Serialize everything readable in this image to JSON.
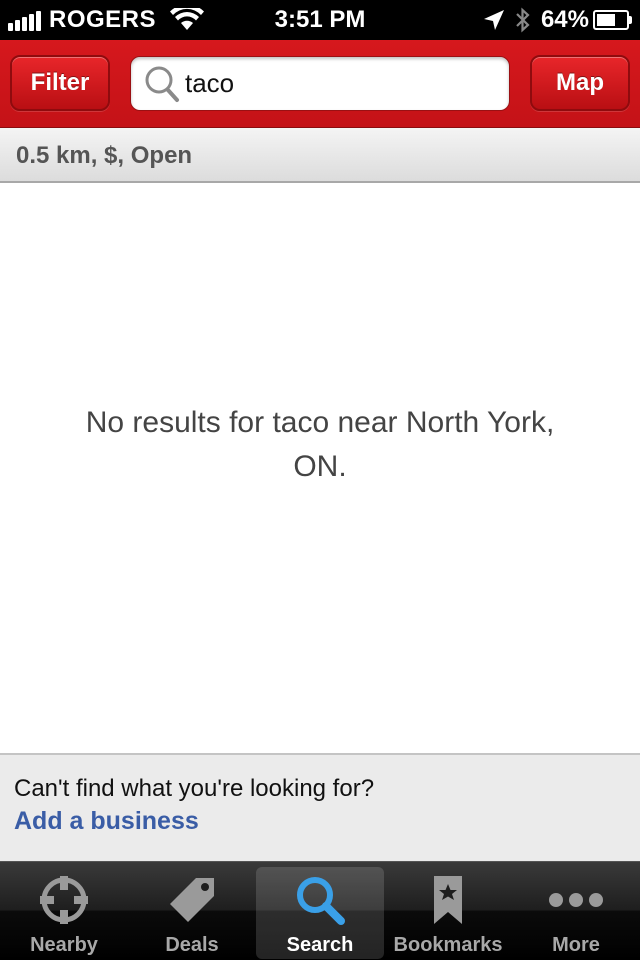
{
  "status_bar": {
    "carrier": "ROGERS",
    "time": "3:51 PM",
    "battery": "64%",
    "battery_level": 0.64
  },
  "header": {
    "filter_label": "Filter",
    "map_label": "Map",
    "search_value": "taco"
  },
  "filter_summary": "0.5 km, $, Open",
  "main": {
    "no_results": "No results for taco near North York, ON."
  },
  "prompt": {
    "text": "Can't find what you're looking for?",
    "link": "Add a business"
  },
  "tabs": [
    {
      "label": "Nearby",
      "icon": "crosshair-icon"
    },
    {
      "label": "Deals",
      "icon": "tag-icon"
    },
    {
      "label": "Search",
      "icon": "search-icon",
      "active": true
    },
    {
      "label": "Bookmarks",
      "icon": "bookmark-icon"
    },
    {
      "label": "More",
      "icon": "more-icon"
    }
  ],
  "colors": {
    "brand_red": "#c41217",
    "link_blue": "#3a5da6",
    "search_blue": "#3aa0e8"
  }
}
